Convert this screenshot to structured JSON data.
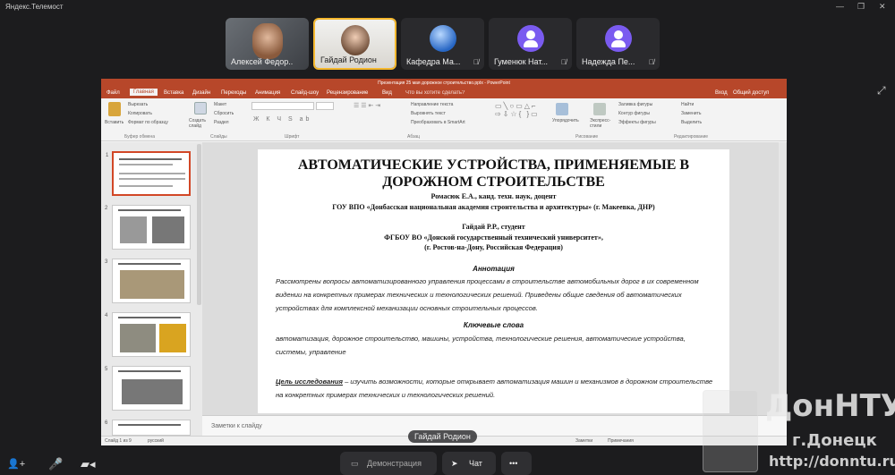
{
  "window": {
    "title": "Яндекс.Телемост"
  },
  "participants": [
    {
      "name": "Алексей Федор...",
      "muted": false,
      "kind": "video"
    },
    {
      "name": "Гайдай Родион",
      "muted": false,
      "kind": "photo",
      "active": true
    },
    {
      "name": "Кафедра  Ма...",
      "muted": true,
      "kind": "globe"
    },
    {
      "name": "Гуменюк Нат...",
      "muted": true,
      "kind": "avatar"
    },
    {
      "name": "Надежда Пе...",
      "muted": true,
      "kind": "avatar"
    }
  ],
  "ppt": {
    "title": "Презентация 25 мая дорожное строительство.pptx - PowerPoint",
    "tabs": [
      "Файл",
      "Главная",
      "Вставка",
      "Дизайн",
      "Переходы",
      "Анимация",
      "Слайд-шоу",
      "Рецензирование",
      "Вид",
      "Что вы хотите сделать?"
    ],
    "account": [
      "Вход",
      "Общий доступ"
    ],
    "ribbon_groups": [
      "Буфер обмена",
      "Слайды",
      "Шрифт",
      "Абзац",
      "Рисование",
      "Редактирование"
    ],
    "ribbon_buttons": {
      "paste": "Вставить",
      "cut": "Вырезать",
      "copy": "Копировать",
      "format": "Формат по образцу",
      "new_slide": "Создать слайд",
      "layout": "Макет",
      "reset": "Сбросить",
      "section": "Раздел",
      "text_dir": "Направление текста",
      "align_text": "Выровнять текст",
      "smartart": "Преобразовать в SmartArt",
      "arrange": "Упорядочить",
      "express": "Экспресс-стили",
      "fill": "Заливка фигуры",
      "outline": "Контур фигуры",
      "effects": "Эффекты фигуры",
      "find": "Найти",
      "replace": "Заменить",
      "select": "Выделить"
    },
    "notes_placeholder": "Заметки к слайду",
    "status": {
      "slide": "Слайд 1 из 9",
      "lang": "русский",
      "notes": "Заметки",
      "comments": "Примечания"
    }
  },
  "slide": {
    "title": "АВТОМАТИЧЕСКИЕ УСТРОЙСТВА, ПРИМЕНЯЕМЫЕ В ДОРОЖНОМ СТРОИТЕЛЬСТВЕ",
    "author1": "Ромасюк Е.А., канд. техн. наук, доцент",
    "org1": "ГОУ ВПО «Донбасская национальная академия строительства и архитектуры» (г. Макеевка, ДНР)",
    "author2": "Гайдай Р.Р., студент",
    "org2": "ФГБОУ ВО «Донской государственный технический университет»,",
    "org2_city": "(г. Ростов-на-Дону, Российская Федерация)",
    "abstract_head": "Аннотация",
    "abstract": "Рассмотрены вопросы автоматизированного управления процессами в строительстве автомобильных дорог в их современном видении на конкретных примерах технических и технологических решений. Приведены общие сведения об автоматических устройствах для комплексной механизации основных строительных процессов.",
    "keywords_head": "Ключевые слова",
    "keywords": "автоматизация, дорожное строительство, машины, устройства, технологические решения, автоматические устройства, системы, управление",
    "goal_label": "Цель исследования",
    "goal": " – изучить возможности, которые открывает автоматизация  машин и механизмов в дорожном строительстве на конкретных примерах  технических и технологических решений."
  },
  "speaker_caption": "Гайдай Родион",
  "controls": {
    "demo": "Демонстрация",
    "chat": "Чат",
    "more": "•••"
  },
  "watermark": {
    "brand": "ДонНТУ",
    "city": "г.Донецк",
    "url": "http://donntu.ru"
  },
  "colors": {
    "accent": "#f5b82e",
    "ppt": "#b7472a",
    "avatar": "#7a5bf0"
  }
}
